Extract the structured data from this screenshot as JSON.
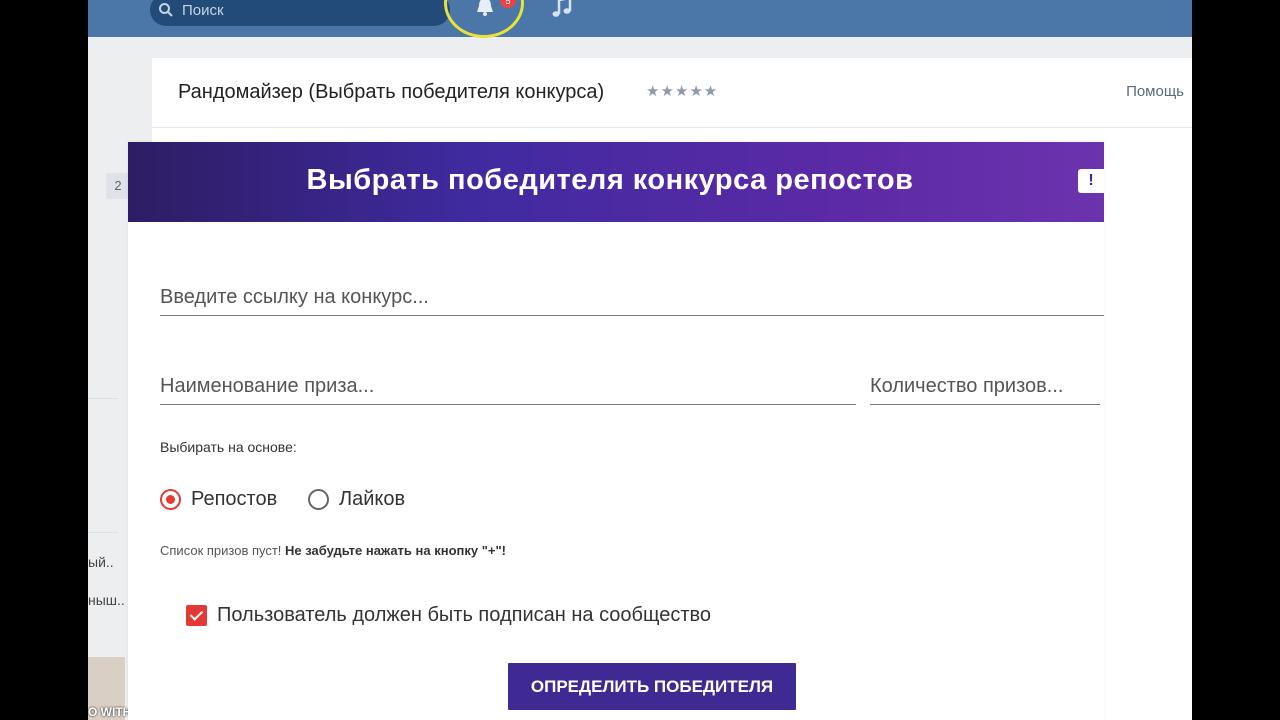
{
  "topbar": {
    "search_placeholder": "Поиск",
    "notification_badge": "5"
  },
  "left_column": {
    "counter": "2",
    "snippet_1": "ый..",
    "snippet_2": "ныш..",
    "thumb_label": "O WITH"
  },
  "app": {
    "title": "Рандомайзер (Выбрать победителя конкурса)",
    "stars": "★★★★★",
    "help": "Помощь"
  },
  "form": {
    "banner_title": "Выбрать победителя конкурса репостов",
    "banner_button": "!",
    "link_placeholder": "Введите ссылку на конкурс...",
    "prize_placeholder": "Наименование приза...",
    "count_placeholder": "Количество призов...",
    "basis_label": "Выбирать на основе:",
    "radio_reposts": "Репостов",
    "radio_likes": "Лайков",
    "prize_note_start": "Список призов пуст! ",
    "prize_note_bold": "Не забудьте нажать на кнопку \"+\"!",
    "subscribe_label": "Пользователь должен быть подписан на сообщество",
    "submit": "Определить победителя"
  }
}
